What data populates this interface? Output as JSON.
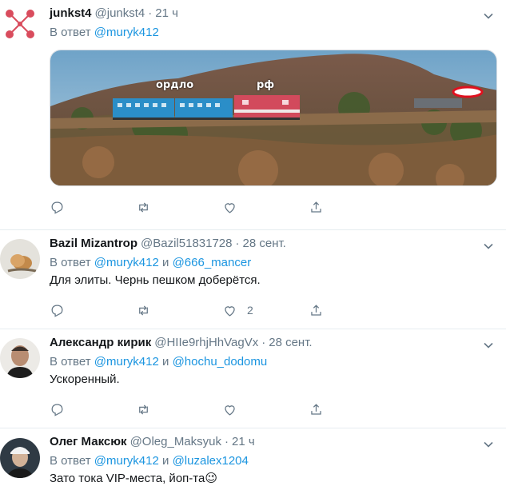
{
  "tweets": [
    {
      "name": "junkst4",
      "handle": "@junkst4",
      "time": "21 ч",
      "reply_prefix": "В ответ",
      "reply_to_1": "@muryk412",
      "image_labels": {
        "left": "ордло",
        "right": "рф"
      },
      "counts": {
        "reply": "",
        "retweet": "",
        "like": "",
        "share": ""
      }
    },
    {
      "name": "Bazil Mizantrop",
      "handle": "@Bazil51831728",
      "time": "28 сент.",
      "reply_prefix": "В ответ",
      "reply_to_1": "@muryk412",
      "reply_joiner": "и",
      "reply_to_2": "@666_mancer",
      "text": "Для элиты. Чернь пешком доберётся.",
      "counts": {
        "reply": "",
        "retweet": "",
        "like": "2",
        "share": ""
      }
    },
    {
      "name": "Александр кирик",
      "handle": "@HIIe9rhjHhVagVx",
      "time": "28 сент.",
      "reply_prefix": "В ответ",
      "reply_to_1": "@muryk412",
      "reply_joiner": "и",
      "reply_to_2": "@hochu_dodomu",
      "text": "Ускоренный.",
      "counts": {
        "reply": "",
        "retweet": "",
        "like": "",
        "share": ""
      }
    },
    {
      "name": "Олег Максюк",
      "handle": "@Oleg_Maksyuk",
      "time": "21 ч",
      "reply_prefix": "В ответ",
      "reply_to_1": "@muryk412",
      "reply_joiner": "и",
      "reply_to_2": "@luzalex1204",
      "text": "Зато тока VIP-места, йоп-та",
      "emoji": "😉"
    }
  ],
  "colors": {
    "link": "#1b95e0",
    "secondary": "#657786",
    "border": "#e6ecf0"
  },
  "icons": [
    "reply-icon",
    "retweet-icon",
    "like-icon",
    "share-icon",
    "caret-down-icon"
  ]
}
